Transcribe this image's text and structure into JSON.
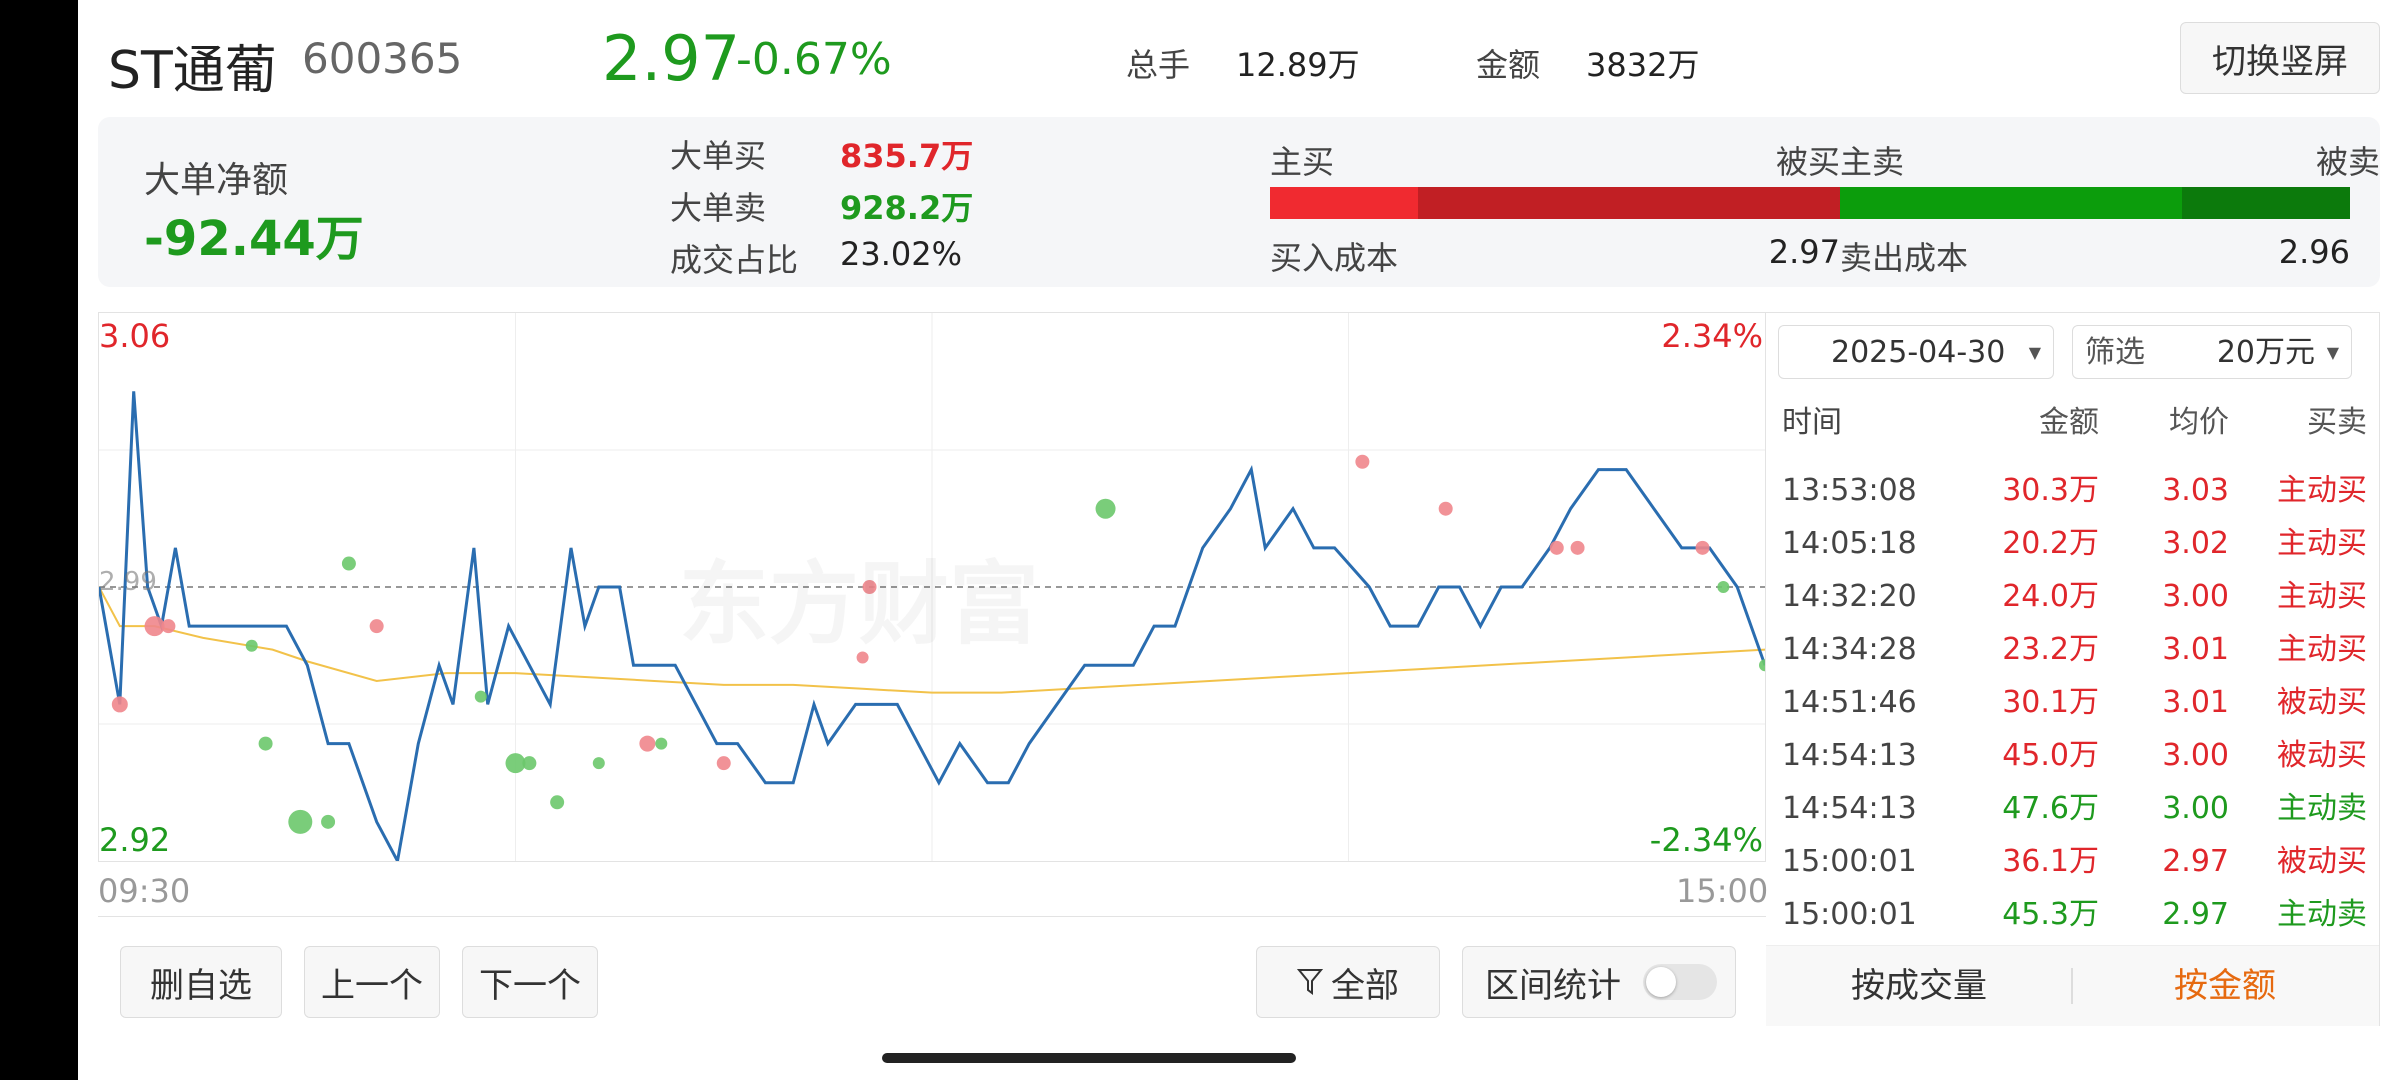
{
  "header": {
    "stock_name": "ST通葡",
    "stock_code": "600365",
    "price": "2.97",
    "change_pct": "-0.67%",
    "volume_label": "总手",
    "volume_value": "12.89万",
    "amount_label": "金额",
    "amount_value": "3832万",
    "switch_label": "切换竖屏"
  },
  "summary": {
    "net_label": "大单净额",
    "net_value": "-92.44万",
    "big_buy_label": "大单买",
    "big_buy_value": "835.7万",
    "big_sell_label": "大单卖",
    "big_sell_value": "928.2万",
    "ratio_label": "成交占比",
    "ratio_value": "23.02%",
    "buy_active_label": "主买",
    "buy_passive_label": "被买",
    "buy_active_fraction": 0.26,
    "buy_cost_label": "买入成本",
    "buy_cost_value": "2.97",
    "sell_active_label": "主卖",
    "sell_passive_label": "被卖",
    "sell_active_fraction": 0.67,
    "sell_cost_label": "卖出成本",
    "sell_cost_value": "2.96"
  },
  "chart": {
    "high_price": "3.06",
    "low_price": "2.92",
    "high_pct": "2.34%",
    "low_pct": "-2.34%",
    "ref_price": "2.99",
    "start_time": "09:30",
    "end_time": "15:00",
    "watermark": "东方财富",
    "colors": {
      "price_line": "#2a6db0",
      "avg_line": "#f2c24a",
      "buy_dot": "#f0868c",
      "sell_dot": "#6cc86c"
    }
  },
  "chart_data": {
    "type": "line",
    "ylim": [
      2.92,
      3.06
    ],
    "xlim": [
      0,
      240
    ],
    "ref": 2.99,
    "series": [
      {
        "values": [
          [
            0,
            2.99
          ],
          [
            3,
            2.96
          ],
          [
            5,
            3.04
          ],
          [
            7,
            2.99
          ],
          [
            9,
            2.98
          ],
          [
            11,
            3.0
          ],
          [
            13,
            2.98
          ],
          [
            17,
            2.98
          ],
          [
            22,
            2.98
          ],
          [
            24,
            2.98
          ],
          [
            27,
            2.98
          ],
          [
            30,
            2.97
          ],
          [
            33,
            2.95
          ],
          [
            36,
            2.95
          ],
          [
            40,
            2.93
          ],
          [
            43,
            2.92
          ],
          [
            46,
            2.95
          ],
          [
            49,
            2.97
          ],
          [
            51,
            2.96
          ],
          [
            54,
            3.0
          ],
          [
            56,
            2.96
          ],
          [
            59,
            2.98
          ],
          [
            62,
            2.97
          ],
          [
            65,
            2.96
          ],
          [
            68,
            3.0
          ],
          [
            70,
            2.98
          ],
          [
            72,
            2.99
          ],
          [
            75,
            2.99
          ],
          [
            77,
            2.97
          ],
          [
            80,
            2.97
          ],
          [
            83,
            2.97
          ],
          [
            86,
            2.96
          ],
          [
            89,
            2.95
          ],
          [
            92,
            2.95
          ],
          [
            96,
            2.94
          ],
          [
            100,
            2.94
          ],
          [
            103,
            2.96
          ],
          [
            105,
            2.95
          ],
          [
            109,
            2.96
          ],
          [
            112,
            2.96
          ],
          [
            115,
            2.96
          ],
          [
            118,
            2.95
          ],
          [
            121,
            2.94
          ],
          [
            124,
            2.95
          ],
          [
            128,
            2.94
          ],
          [
            131,
            2.94
          ],
          [
            134,
            2.95
          ],
          [
            138,
            2.96
          ],
          [
            142,
            2.97
          ],
          [
            146,
            2.97
          ],
          [
            149,
            2.97
          ],
          [
            152,
            2.98
          ],
          [
            155,
            2.98
          ],
          [
            159,
            3.0
          ],
          [
            163,
            3.01
          ],
          [
            166,
            3.02
          ],
          [
            168,
            3.0
          ],
          [
            172,
            3.01
          ],
          [
            175,
            3.0
          ],
          [
            178,
            3.0
          ],
          [
            183,
            2.99
          ],
          [
            186,
            2.98
          ],
          [
            190,
            2.98
          ],
          [
            193,
            2.99
          ],
          [
            196,
            2.99
          ],
          [
            199,
            2.98
          ],
          [
            202,
            2.99
          ],
          [
            205,
            2.99
          ],
          [
            209,
            3.0
          ],
          [
            212,
            3.01
          ],
          [
            216,
            3.02
          ],
          [
            220,
            3.02
          ],
          [
            224,
            3.01
          ],
          [
            228,
            3.0
          ],
          [
            232,
            3.0
          ],
          [
            236,
            2.99
          ],
          [
            240,
            2.97
          ]
        ]
      },
      {
        "values": [
          [
            0,
            2.99
          ],
          [
            3,
            2.98
          ],
          [
            8,
            2.98
          ],
          [
            15,
            2.977
          ],
          [
            25,
            2.974
          ],
          [
            30,
            2.971
          ],
          [
            40,
            2.966
          ],
          [
            50,
            2.968
          ],
          [
            60,
            2.968
          ],
          [
            70,
            2.967
          ],
          [
            80,
            2.966
          ],
          [
            90,
            2.965
          ],
          [
            100,
            2.965
          ],
          [
            110,
            2.964
          ],
          [
            120,
            2.963
          ],
          [
            130,
            2.963
          ],
          [
            140,
            2.964
          ],
          [
            150,
            2.965
          ],
          [
            160,
            2.966
          ],
          [
            170,
            2.967
          ],
          [
            180,
            2.968
          ],
          [
            190,
            2.969
          ],
          [
            200,
            2.97
          ],
          [
            210,
            2.971
          ],
          [
            220,
            2.972
          ],
          [
            230,
            2.973
          ],
          [
            240,
            2.974
          ]
        ]
      }
    ]
  },
  "trades": {
    "date": "2025-04-30",
    "filter_label": "筛选",
    "filter_value": "20万元",
    "col_time": "时间",
    "col_amount": "金额",
    "col_price": "均价",
    "col_side": "买卖",
    "rows": [
      {
        "time": "13:53:08",
        "amount": "30.3万",
        "price": "3.03",
        "side": "主动买",
        "color": "#e0262b"
      },
      {
        "time": "14:05:18",
        "amount": "20.2万",
        "price": "3.02",
        "side": "主动买",
        "color": "#e0262b"
      },
      {
        "time": "14:32:20",
        "amount": "24.0万",
        "price": "3.00",
        "side": "主动买",
        "color": "#e0262b"
      },
      {
        "time": "14:34:28",
        "amount": "23.2万",
        "price": "3.01",
        "side": "主动买",
        "color": "#e0262b"
      },
      {
        "time": "14:51:46",
        "amount": "30.1万",
        "price": "3.01",
        "side": "被动买",
        "color": "#e0262b"
      },
      {
        "time": "14:54:13",
        "amount": "45.0万",
        "price": "3.00",
        "side": "被动买",
        "color": "#e0262b"
      },
      {
        "time": "14:54:13",
        "amount": "47.6万",
        "price": "3.00",
        "side": "主动卖",
        "color": "#1e9a1e"
      },
      {
        "time": "15:00:01",
        "amount": "36.1万",
        "price": "2.97",
        "side": "被动买",
        "color": "#e0262b"
      },
      {
        "time": "15:00:01",
        "amount": "45.3万",
        "price": "2.97",
        "side": "主动卖",
        "color": "#1e9a1e"
      }
    ],
    "by_volume_label": "按成交量",
    "by_amount_label": "按金额"
  },
  "footer": {
    "remove_label": "删自选",
    "prev_label": "上一个",
    "next_label": "下一个",
    "all_label": "全部",
    "range_label": "区间统计"
  }
}
